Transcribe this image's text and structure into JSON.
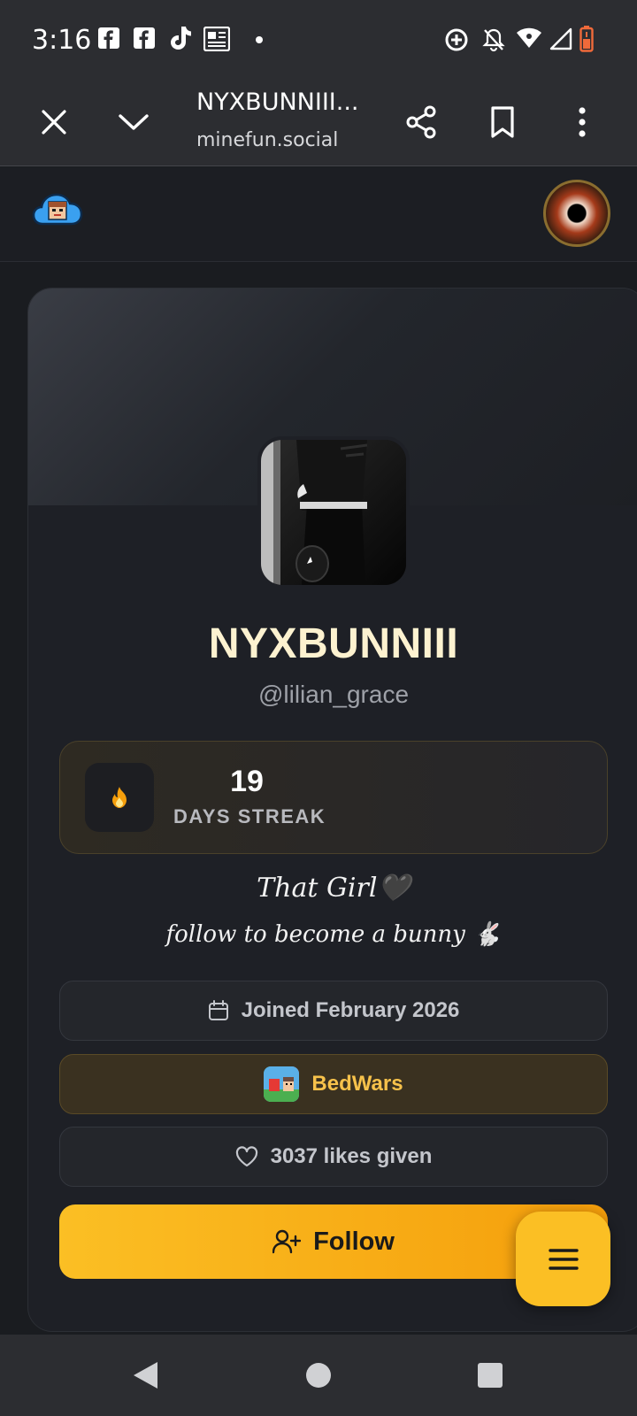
{
  "status_bar": {
    "time": "3:16",
    "left_icons": [
      "facebook-icon",
      "facebook-icon",
      "tiktok-icon",
      "news-icon"
    ],
    "right_icons": [
      "data-saver-icon",
      "notifications-off-icon",
      "wifi-icon",
      "signal-icon",
      "battery-low-icon"
    ]
  },
  "browser": {
    "title": "NYXBUNNIII...",
    "url": "minefun.social"
  },
  "profile": {
    "display_name": "NYXBUNNIII",
    "username": "@lilian_grace",
    "streak_count": "19",
    "streak_label": "DAYS STREAK",
    "bio_line1": "That Girl🖤",
    "bio_line2": "follow to become a bunny 🐇",
    "joined": "Joined February 2026",
    "game": "BedWars",
    "likes": "3037 likes given",
    "follow_label": "Follow"
  },
  "colors": {
    "accent": "#fbbf24",
    "name": "#fdf2d0"
  }
}
